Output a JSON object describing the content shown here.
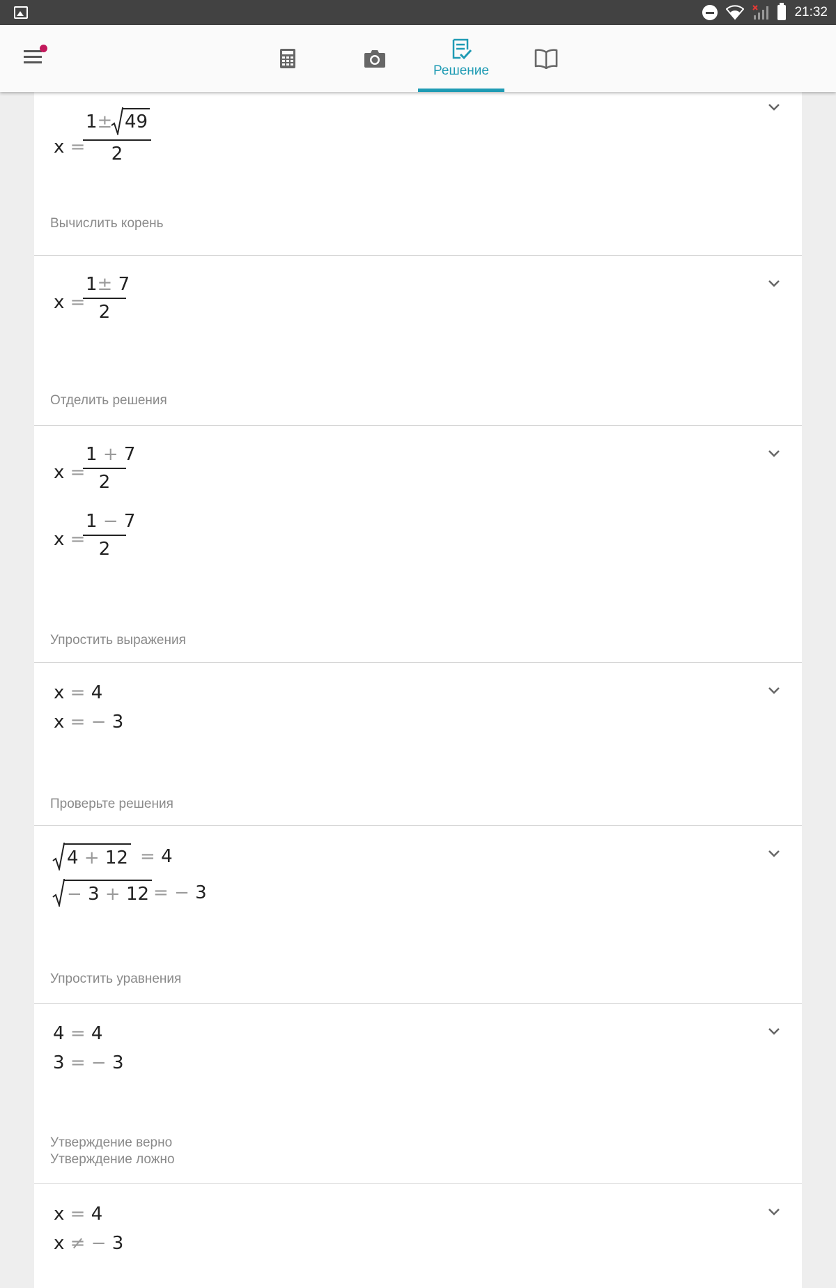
{
  "status_bar": {
    "time": "21:32"
  },
  "app_bar": {
    "tabs": [
      {
        "icon": "calculator-icon"
      },
      {
        "icon": "camera-icon"
      },
      {
        "icon": "solution-icon",
        "label": "Решение",
        "active": true
      },
      {
        "icon": "book-icon"
      }
    ],
    "accent_color": "#1f9bb4",
    "notification_color": "#c2185b"
  },
  "steps": [
    {
      "lines": [
        {
          "var": "x",
          "eq": "=",
          "num_a": "1",
          "pm": "±",
          "radicand": "49",
          "den": "2"
        }
      ],
      "caption": "Вычислить корень"
    },
    {
      "lines": [
        {
          "var": "x",
          "eq": "=",
          "num_a": "1",
          "pm": "±",
          "num_b": "7",
          "den": "2"
        }
      ],
      "caption": "Отделить решения"
    },
    {
      "lines": [
        {
          "var": "x",
          "eq": "=",
          "num_a": "1",
          "op": "+",
          "num_b": "7",
          "den": "2"
        },
        {
          "var": "x",
          "eq": "=",
          "num_a": "1",
          "op": "−",
          "num_b": "7",
          "den": "2"
        }
      ],
      "caption": "Упростить выражения"
    },
    {
      "lines": [
        {
          "var": "x",
          "eq": "=",
          "rhs": "4"
        },
        {
          "var": "x",
          "eq": "=",
          "rhs_op": "−",
          "rhs": "3"
        }
      ],
      "caption": "Проверьте решения"
    },
    {
      "lines": [
        {
          "rad_a": "4",
          "rad_op": "+",
          "rad_b": "12",
          "eq": "=",
          "rhs": "4"
        },
        {
          "rad_a_op": "−",
          "rad_a": "3",
          "rad_op": "+",
          "rad_b": "12",
          "eq": "=",
          "rhs_op": "−",
          "rhs": "3"
        }
      ],
      "caption": "Упростить уравнения"
    },
    {
      "lines": [
        {
          "lhs": "4",
          "eq": "=",
          "rhs": "4"
        },
        {
          "lhs": "3",
          "eq": "=",
          "rhs_op": "−",
          "rhs": "3"
        }
      ],
      "caption_lines": [
        "Утверждение верно",
        "Утверждение ложно"
      ]
    },
    {
      "lines": [
        {
          "var": "x",
          "eq": "=",
          "rhs": "4"
        },
        {
          "var": "x",
          "eq": "≠",
          "rhs_op": "−",
          "rhs": "3"
        }
      ]
    }
  ]
}
